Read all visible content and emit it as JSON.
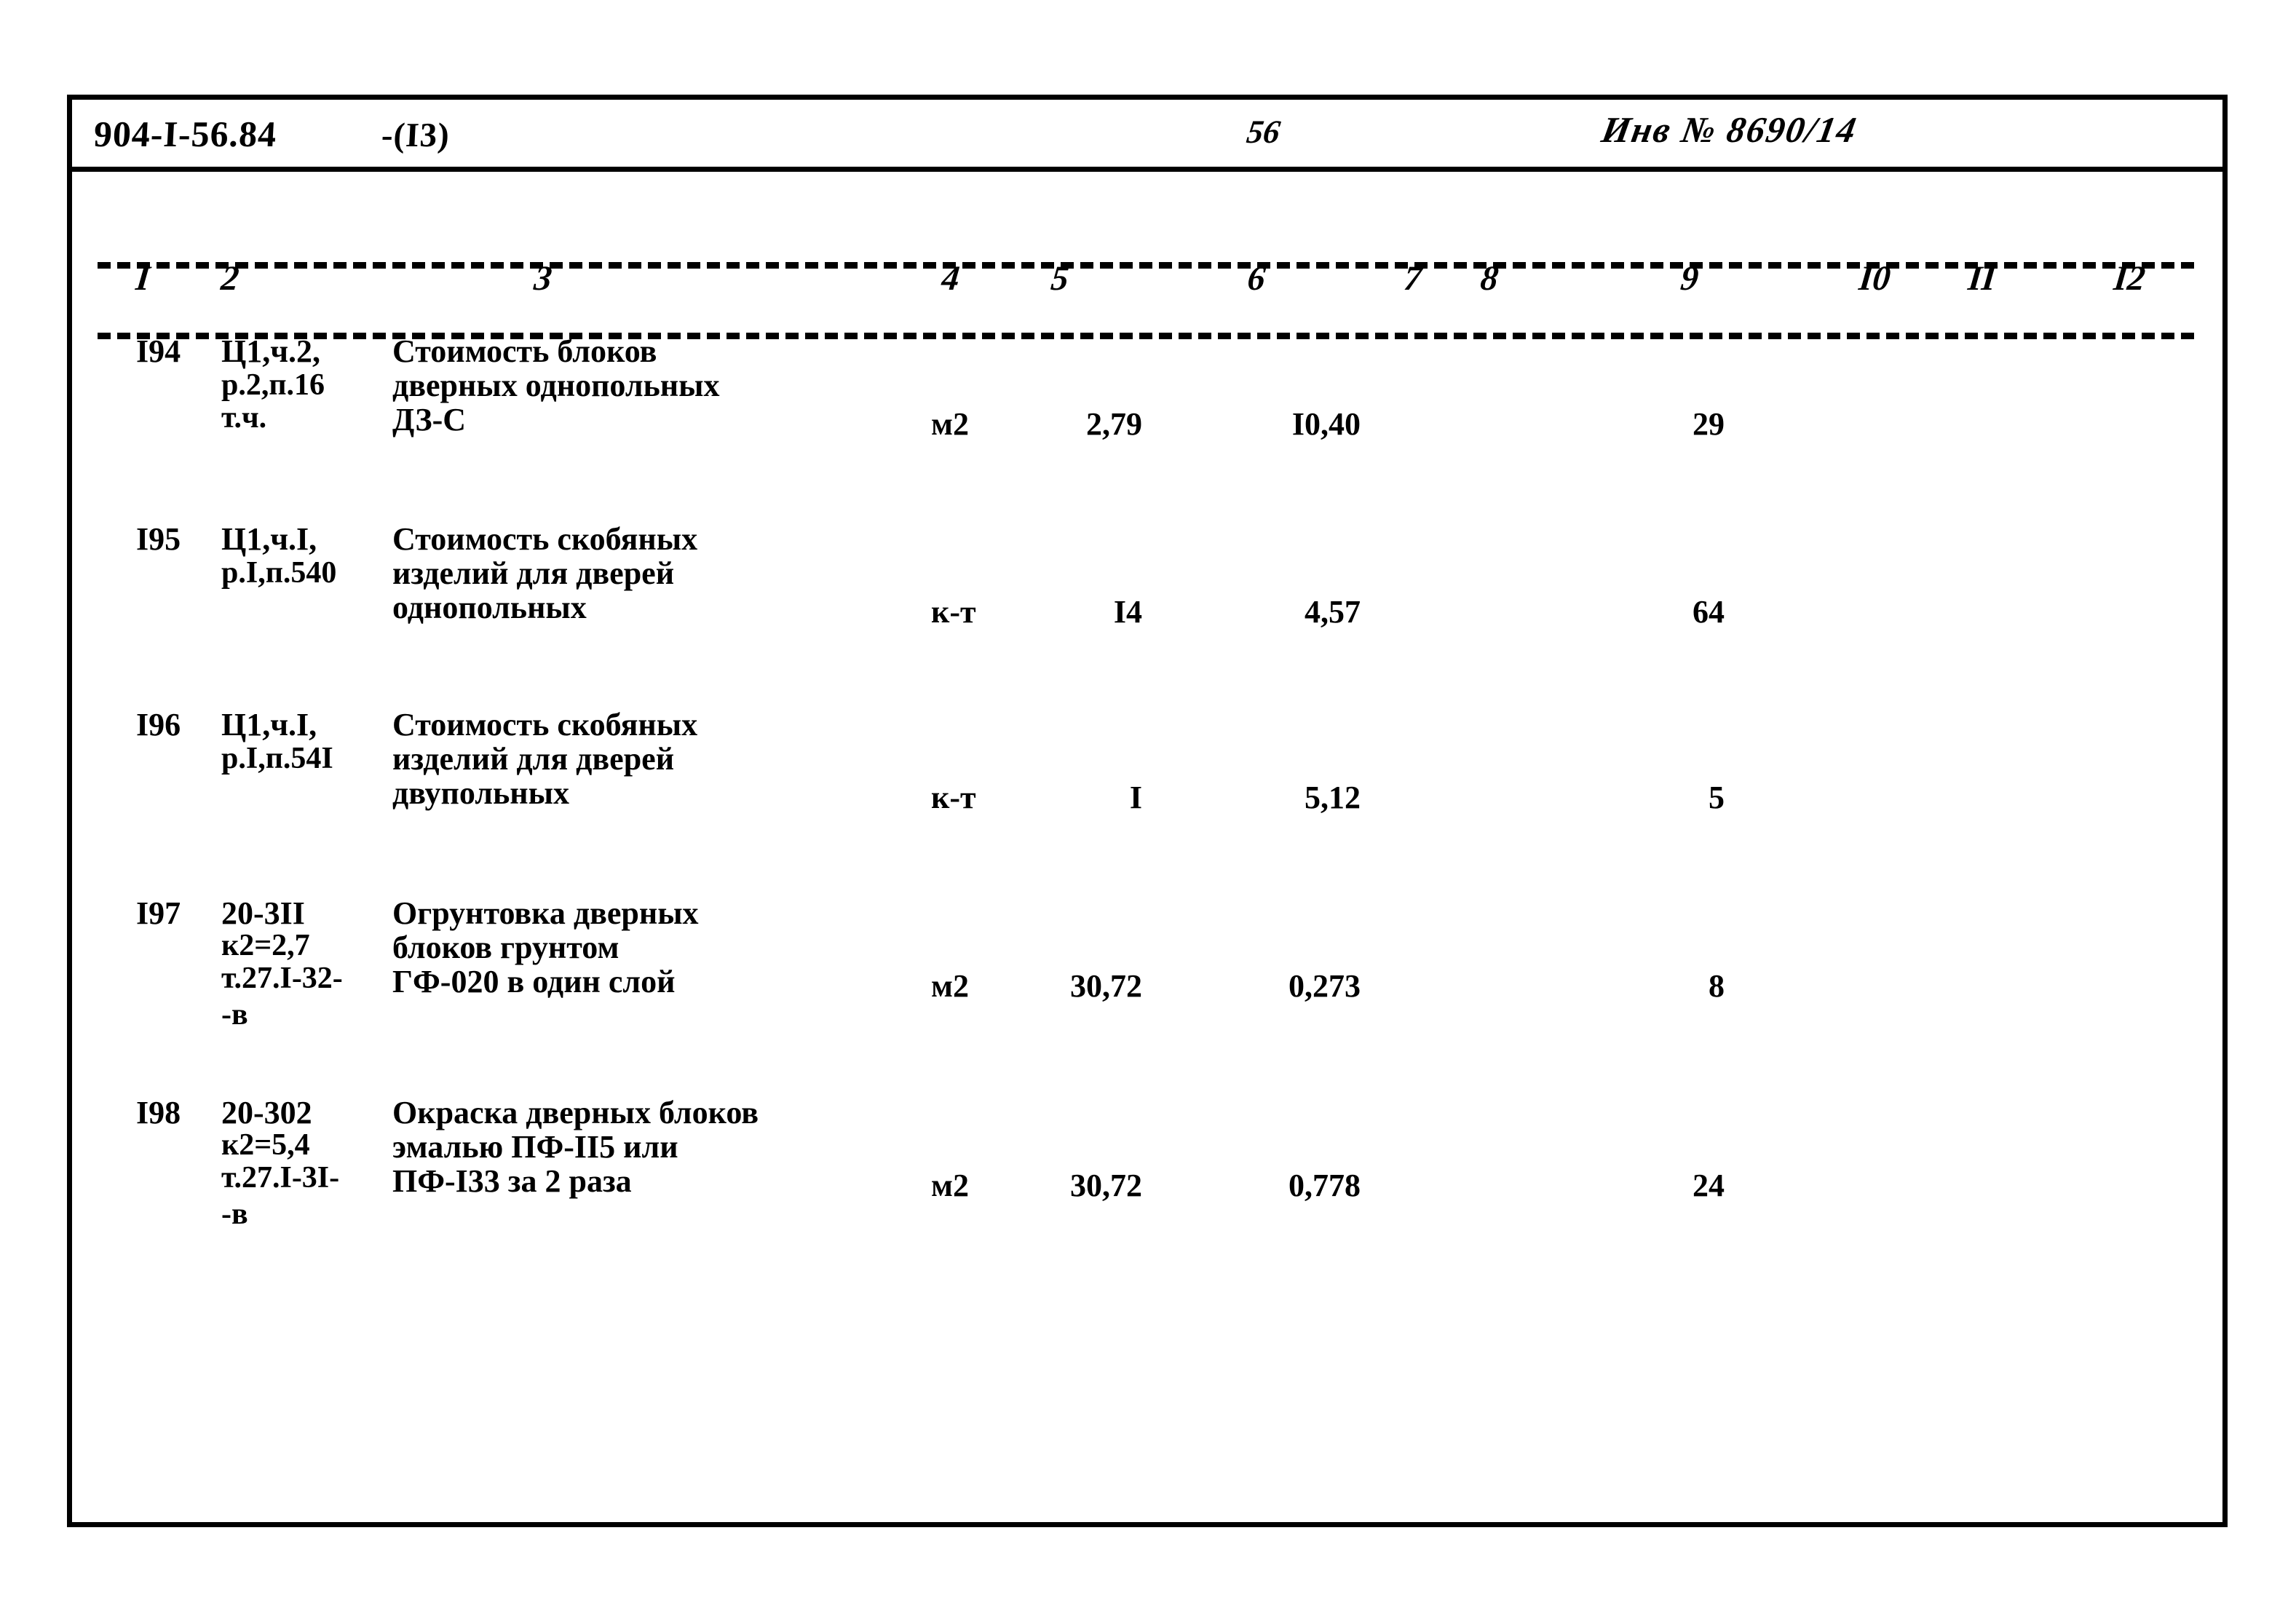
{
  "header": {
    "doc_code": "904-I-56.84",
    "sheet_ref": "-(I3)",
    "page_number": "56",
    "inventory": "Инв № 8690/14"
  },
  "table": {
    "column_numbers": [
      "I",
      "2",
      "3",
      "4",
      "5",
      "6",
      "7",
      "8",
      "9",
      "I0",
      "II",
      "I2"
    ],
    "rows": [
      {
        "pos": "I94",
        "code_lines": [
          "Ц1,ч.2,",
          "р.2,п.16",
          "т.ч."
        ],
        "description_lines": [
          "Стоимость блоков",
          "дверных однопольных",
          "ДЗ-С"
        ],
        "unit": "м2",
        "quantity": "2,79",
        "price": "I0,40",
        "total": "29"
      },
      {
        "pos": "I95",
        "code_lines": [
          "Ц1,ч.I,",
          "р.I,п.540"
        ],
        "description_lines": [
          "Стоимость скобяных",
          "изделий для дверей",
          "однопольных"
        ],
        "unit": "к-т",
        "quantity": "I4",
        "price": "4,57",
        "total": "64"
      },
      {
        "pos": "I96",
        "code_lines": [
          "Ц1,ч.I,",
          "р.I,п.54I"
        ],
        "description_lines": [
          "Стоимость скобяных",
          "изделий для дверей",
          "двупольных"
        ],
        "unit": "к-т",
        "quantity": "I",
        "price": "5,12",
        "total": "5"
      },
      {
        "pos": "I97",
        "code_lines": [
          "20-3II",
          "к2=2,7",
          "т.27.I-32-",
          "-в"
        ],
        "description_lines": [
          "Огрунтовка дверных",
          "блоков грунтом",
          "ГФ-020 в один слой"
        ],
        "unit": "м2",
        "quantity": "30,72",
        "price": "0,273",
        "total": "8"
      },
      {
        "pos": "I98",
        "code_lines": [
          "20-302",
          "к2=5,4",
          "т.27.I-3I-",
          "-в"
        ],
        "description_lines": [
          "Окраска дверных блоков",
          "эмалью ПФ-II5 или",
          "ПФ-I33 за 2 раза"
        ],
        "unit": "м2",
        "quantity": "30,72",
        "price": "0,778",
        "total": "24"
      }
    ]
  }
}
